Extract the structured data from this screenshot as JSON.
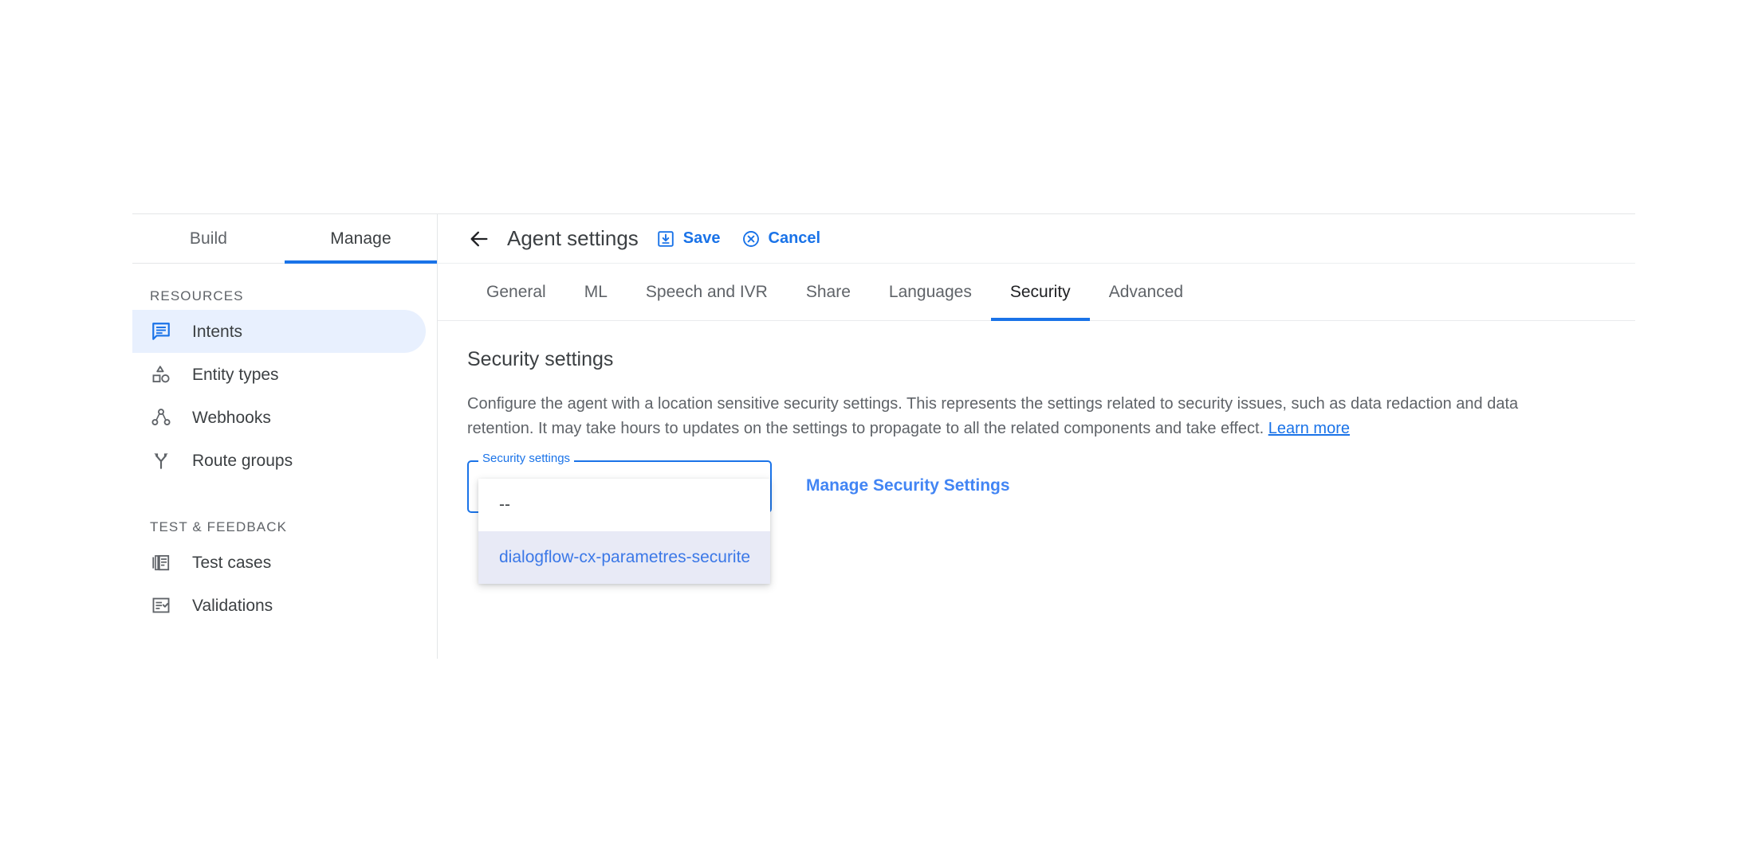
{
  "left_panel": {
    "mode_tabs": [
      {
        "label": "Build",
        "active": false
      },
      {
        "label": "Manage",
        "active": true
      }
    ],
    "sections": [
      {
        "title": "RESOURCES",
        "items": [
          {
            "label": "Intents",
            "icon": "chat-bubble-icon",
            "selected": true
          },
          {
            "label": "Entity types",
            "icon": "shapes-icon",
            "selected": false
          },
          {
            "label": "Webhooks",
            "icon": "hub-nodes-icon",
            "selected": false
          },
          {
            "label": "Route groups",
            "icon": "call-split-icon",
            "selected": false
          }
        ]
      },
      {
        "title": "TEST & FEEDBACK",
        "items": [
          {
            "label": "Test cases",
            "icon": "test-cases-icon",
            "selected": false
          },
          {
            "label": "Validations",
            "icon": "checklist-icon",
            "selected": false
          }
        ]
      }
    ]
  },
  "header": {
    "back_icon": "arrow-back-icon",
    "title": "Agent settings",
    "save_label": "Save",
    "save_icon": "save-icon",
    "cancel_label": "Cancel",
    "cancel_icon": "cancel-circle-icon"
  },
  "tabs": [
    {
      "label": "General",
      "active": false
    },
    {
      "label": "ML",
      "active": false
    },
    {
      "label": "Speech and IVR",
      "active": false
    },
    {
      "label": "Share",
      "active": false
    },
    {
      "label": "Languages",
      "active": false
    },
    {
      "label": "Security",
      "active": true
    },
    {
      "label": "Advanced",
      "active": false
    }
  ],
  "content": {
    "heading": "Security settings",
    "description_part1": "Configure the agent with a location sensitive security settings. This represents the settings related to security issues, such as data redaction and data retention. It may take hours to updates on the settings to propagate to all the related components and take effect. ",
    "learn_more_label": "Learn more",
    "field": {
      "label": "Security settings",
      "value": "",
      "options": [
        {
          "label": "--",
          "selected": false
        },
        {
          "label": "dialogflow-cx-parametres-securite",
          "selected": true
        }
      ]
    },
    "manage_link_label": "Manage Security Settings"
  },
  "colors": {
    "accent": "#1a73e8",
    "link": "#4285f4",
    "selected_nav_bg": "#e8f0fe",
    "selected_option_bg": "#e8eaf6",
    "text_primary": "#3c4043",
    "text_secondary": "#5f6368"
  }
}
